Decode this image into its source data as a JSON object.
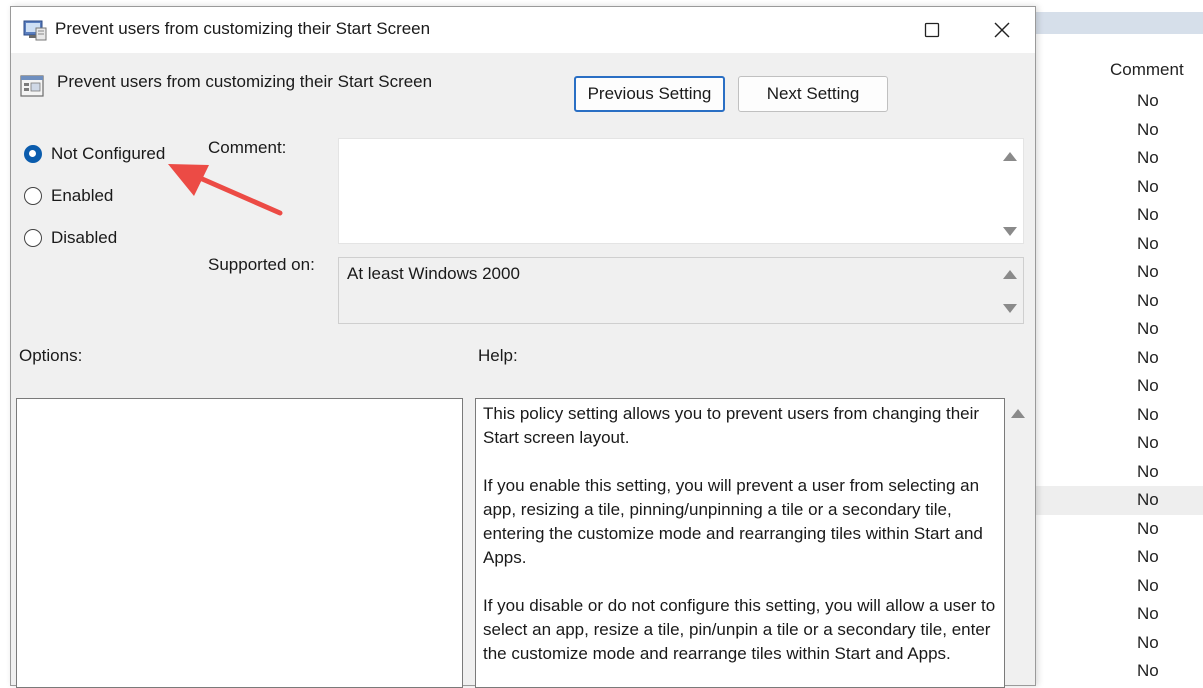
{
  "dialog": {
    "title": "Prevent users from customizing their Start Screen",
    "header": "Prevent users from customizing their Start Screen",
    "buttons": {
      "previous": "Previous Setting",
      "next": "Next Setting"
    },
    "state_options": [
      {
        "label": "Not Configured",
        "selected": true
      },
      {
        "label": "Enabled",
        "selected": false
      },
      {
        "label": "Disabled",
        "selected": false
      }
    ],
    "comment_label": "Comment:",
    "comment_value": "",
    "supported_label": "Supported on:",
    "supported_value": "At least Windows 2000",
    "options_label": "Options:",
    "help_label": "Help:",
    "help_paragraphs": [
      "This policy setting allows you to prevent users from changing their Start screen layout.",
      "If you enable this setting, you will prevent a user from selecting an app, resizing a tile, pinning/unpinning a tile or a secondary tile, entering the customize mode and rearranging tiles within Start and Apps.",
      "If you disable or do not configure this setting, you will allow a user to select an app, resize a tile, pin/unpin a tile or a secondary tile, enter the customize mode and rearrange tiles within Start and Apps."
    ]
  },
  "background_list": {
    "column_header": "Comment",
    "rows": [
      "No",
      "No",
      "No",
      "No",
      "No",
      "No",
      "No",
      "No",
      "No",
      "No",
      "No",
      "No",
      "No",
      "No",
      "No",
      "No",
      "No",
      "No",
      "No",
      "No",
      "No"
    ],
    "highlighted_row": 14
  },
  "colors": {
    "accent": "#0b5cad",
    "annotation_arrow": "#ec4b45"
  },
  "icons": {
    "title": "policy-window-icon",
    "header": "policy-settings-icon",
    "annotation": "red-arrow-icon"
  }
}
